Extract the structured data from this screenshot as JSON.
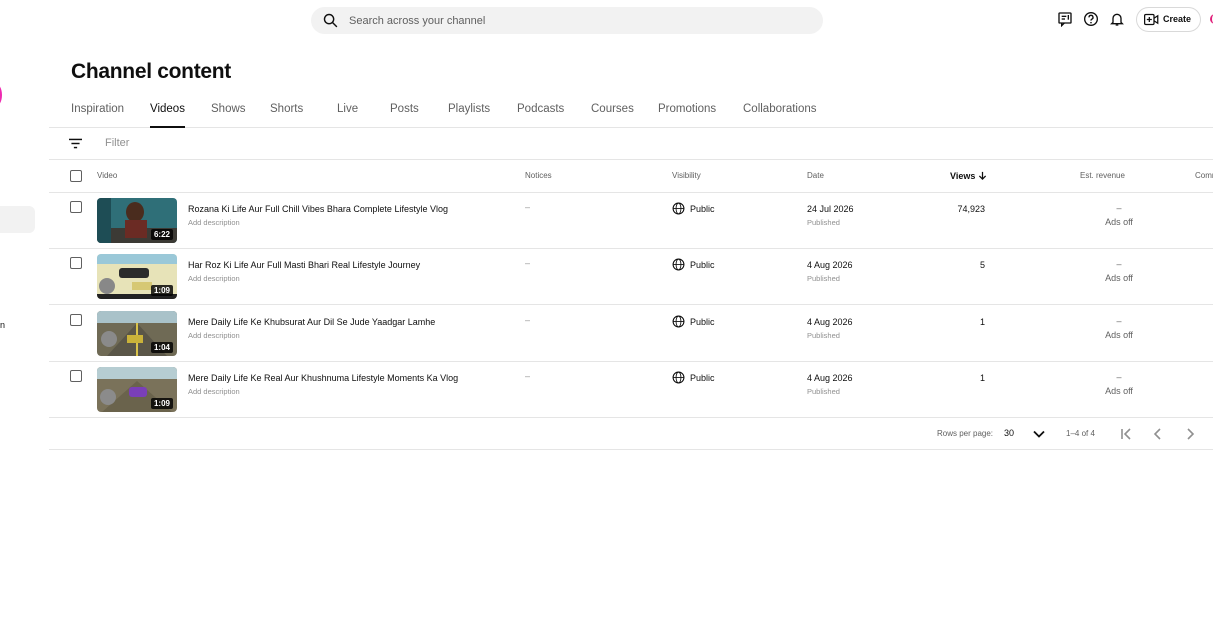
{
  "search": {
    "placeholder": "Search across your channel"
  },
  "header": {
    "icons": [
      "feedback-icon",
      "help-icon",
      "notifications-bell-icon",
      "create-video-icon"
    ],
    "create_label": "Create"
  },
  "sidebar": {
    "fragment_text": "n"
  },
  "page_title": "Channel content",
  "tabs": [
    {
      "label": "Inspiration"
    },
    {
      "label": "Videos",
      "active": true
    },
    {
      "label": "Shows"
    },
    {
      "label": "Shorts"
    },
    {
      "label": "Live"
    },
    {
      "label": "Posts"
    },
    {
      "label": "Playlists"
    },
    {
      "label": "Podcasts"
    },
    {
      "label": "Courses"
    },
    {
      "label": "Promotions"
    },
    {
      "label": "Collaborations"
    }
  ],
  "filter": {
    "placeholder": "Filter"
  },
  "table": {
    "columns": {
      "video": "Video",
      "notices": "Notices",
      "visibility": "Visibility",
      "date": "Date",
      "views": "Views",
      "revenue": "Est. revenue",
      "comments": "Comm"
    },
    "rows": [
      {
        "title": "Rozana Ki Life Aur Full Chill Vibes Bhara Complete Lifestyle Vlog",
        "description": "Add description",
        "duration": "6:22",
        "notices": "–",
        "visibility": "Public",
        "date": "24 Jul 2026",
        "status": "Published",
        "views": "74,923",
        "revenue": "–",
        "ads": "Ads off"
      },
      {
        "title": "Har Roz Ki Life Aur Full Masti Bhari Real Lifestyle Journey",
        "description": "Add description",
        "duration": "1:09",
        "notices": "–",
        "visibility": "Public",
        "date": "4 Aug 2026",
        "status": "Published",
        "views": "5",
        "revenue": "–",
        "ads": "Ads off"
      },
      {
        "title": "Mere Daily Life Ke Khubsurat Aur Dil Se Jude Yaadgar Lamhe",
        "description": "Add description",
        "duration": "1:04",
        "notices": "–",
        "visibility": "Public",
        "date": "4 Aug 2026",
        "status": "Published",
        "views": "1",
        "revenue": "–",
        "ads": "Ads off"
      },
      {
        "title": "Mere Daily Life Ke Real Aur Khushnuma Lifestyle Moments Ka Vlog",
        "description": "Add description",
        "duration": "1:09",
        "notices": "–",
        "visibility": "Public",
        "date": "4 Aug 2026",
        "status": "Published",
        "views": "1",
        "revenue": "–",
        "ads": "Ads off"
      }
    ]
  },
  "pagination": {
    "rows_per_page_label": "Rows per page:",
    "rows_per_page": "30",
    "range": "1–4 of 4"
  },
  "colors": {
    "accent_pink": "#ee2ab0",
    "divider": "#e5e5e5",
    "search_bg": "#f2f2f2"
  }
}
